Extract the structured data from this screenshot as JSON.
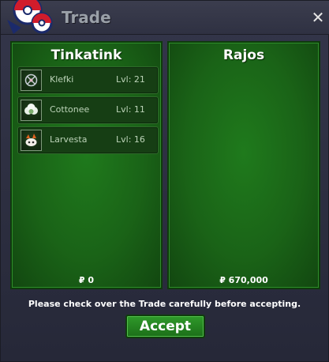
{
  "window": {
    "title": "Trade"
  },
  "left_panel": {
    "player_name": "Tinkatink",
    "money": "₽ 0",
    "items": [
      {
        "name": "Klefki",
        "level": "Lvl: 21",
        "icon": "klefki-icon"
      },
      {
        "name": "Cottonee",
        "level": "Lvl: 11",
        "icon": "cottonee-icon"
      },
      {
        "name": "Larvesta",
        "level": "Lvl: 16",
        "icon": "larvesta-icon"
      }
    ]
  },
  "right_panel": {
    "player_name": "Rajos",
    "money": "₽ 670,000"
  },
  "notice": "Please check over the Trade carefully before accepting.",
  "accept_label": "Accept",
  "close_symbol": "✕",
  "colors": {
    "panel_green": "#1a6317",
    "window_bg": "#2b2d3a"
  }
}
